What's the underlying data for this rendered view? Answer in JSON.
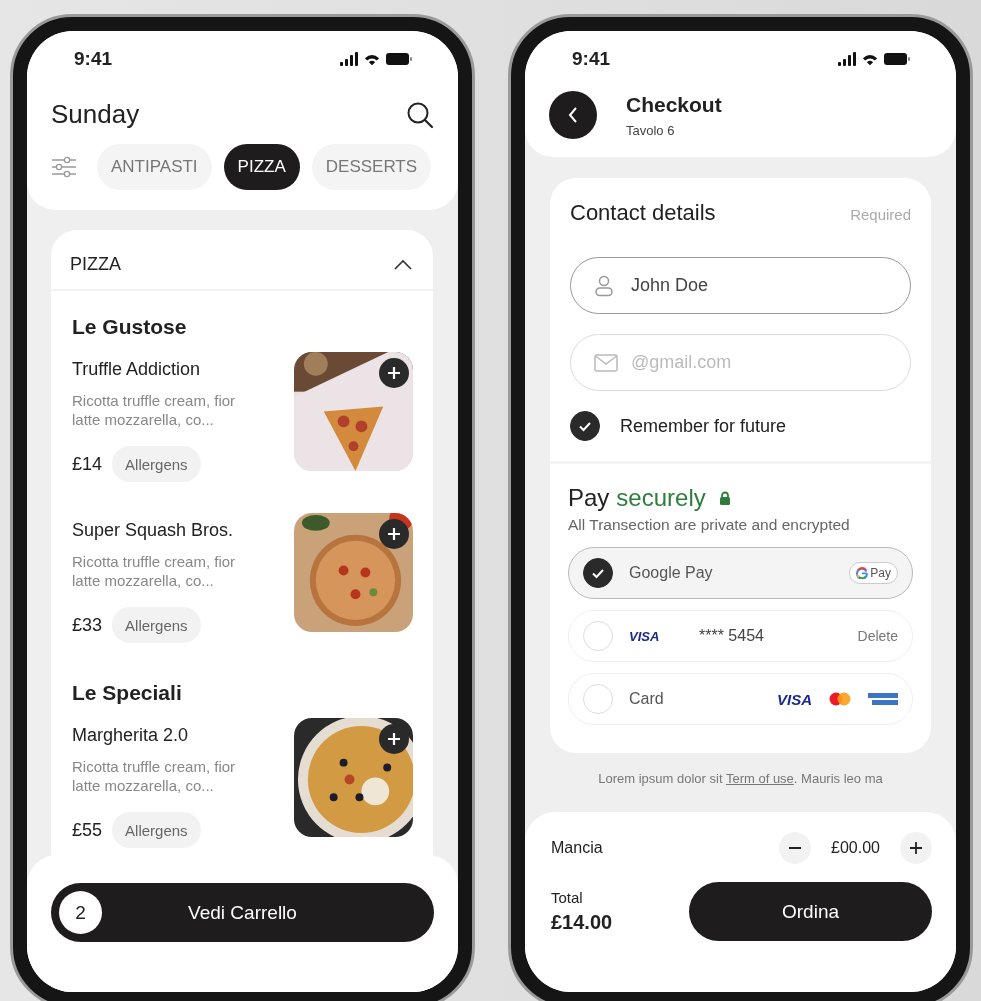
{
  "menu_screen": {
    "status_bar": {
      "time": "9:41"
    },
    "title": "Sunday",
    "tabs": [
      {
        "label": "ANTIPASTI",
        "selected": false
      },
      {
        "label": "PIZZA",
        "selected": true
      },
      {
        "label": "DESSERTS",
        "selected": false
      }
    ],
    "section": {
      "title": "PIZZA",
      "expanded": true,
      "groups": [
        {
          "title": "Le Gustose",
          "items": [
            {
              "name": "Truffle Addiction",
              "description": "Ricotta truffle cream, fior latte mozzarella, co...",
              "price": "£14",
              "allergens": "Allergens"
            },
            {
              "name": "Super Squash Bros.",
              "description": "Ricotta truffle cream, fior latte mozzarella, co...",
              "price": "£33",
              "allergens": "Allergens"
            }
          ]
        },
        {
          "title": "Le Speciali",
          "items": [
            {
              "name": "Margherita 2.0",
              "description": "Ricotta truffle cream, fior latte mozzarella, co...",
              "price": "£55",
              "allergens": "Allergens"
            }
          ]
        }
      ]
    },
    "cart": {
      "count": "2",
      "label": "Vedi Carrello"
    }
  },
  "checkout_screen": {
    "status_bar": {
      "time": "9:41"
    },
    "title": "Checkout",
    "subtitle": "Tavolo 6",
    "contact": {
      "title": "Contact details",
      "note": "Required",
      "name_field": {
        "value": "John Doe"
      },
      "email_field": {
        "placeholder": "@gmail.com"
      },
      "remember": {
        "label": "Remember for future",
        "checked": true
      }
    },
    "payment": {
      "title": "Pay",
      "title_accent": "securely",
      "subtitle": "All Transection are private and encrypted",
      "options": [
        {
          "kind": "gpay",
          "label": "Google Pay",
          "badge": "Pay",
          "selected": true
        },
        {
          "kind": "saved-card",
          "brand": "VISA",
          "number": "**** 5454",
          "action": "Delete",
          "selected": false
        },
        {
          "kind": "card",
          "label": "Card",
          "brand": "VISA",
          "selected": false
        }
      ]
    },
    "terms": {
      "before": "Lorem ipsum dolor sit ",
      "link": "Term of use",
      "after": ". Mauris leo ma"
    },
    "tip": {
      "label": "Mancia",
      "amount": "£00.00"
    },
    "total": {
      "label": "Total",
      "amount": "£14.00"
    },
    "order_button": "Ordina"
  }
}
